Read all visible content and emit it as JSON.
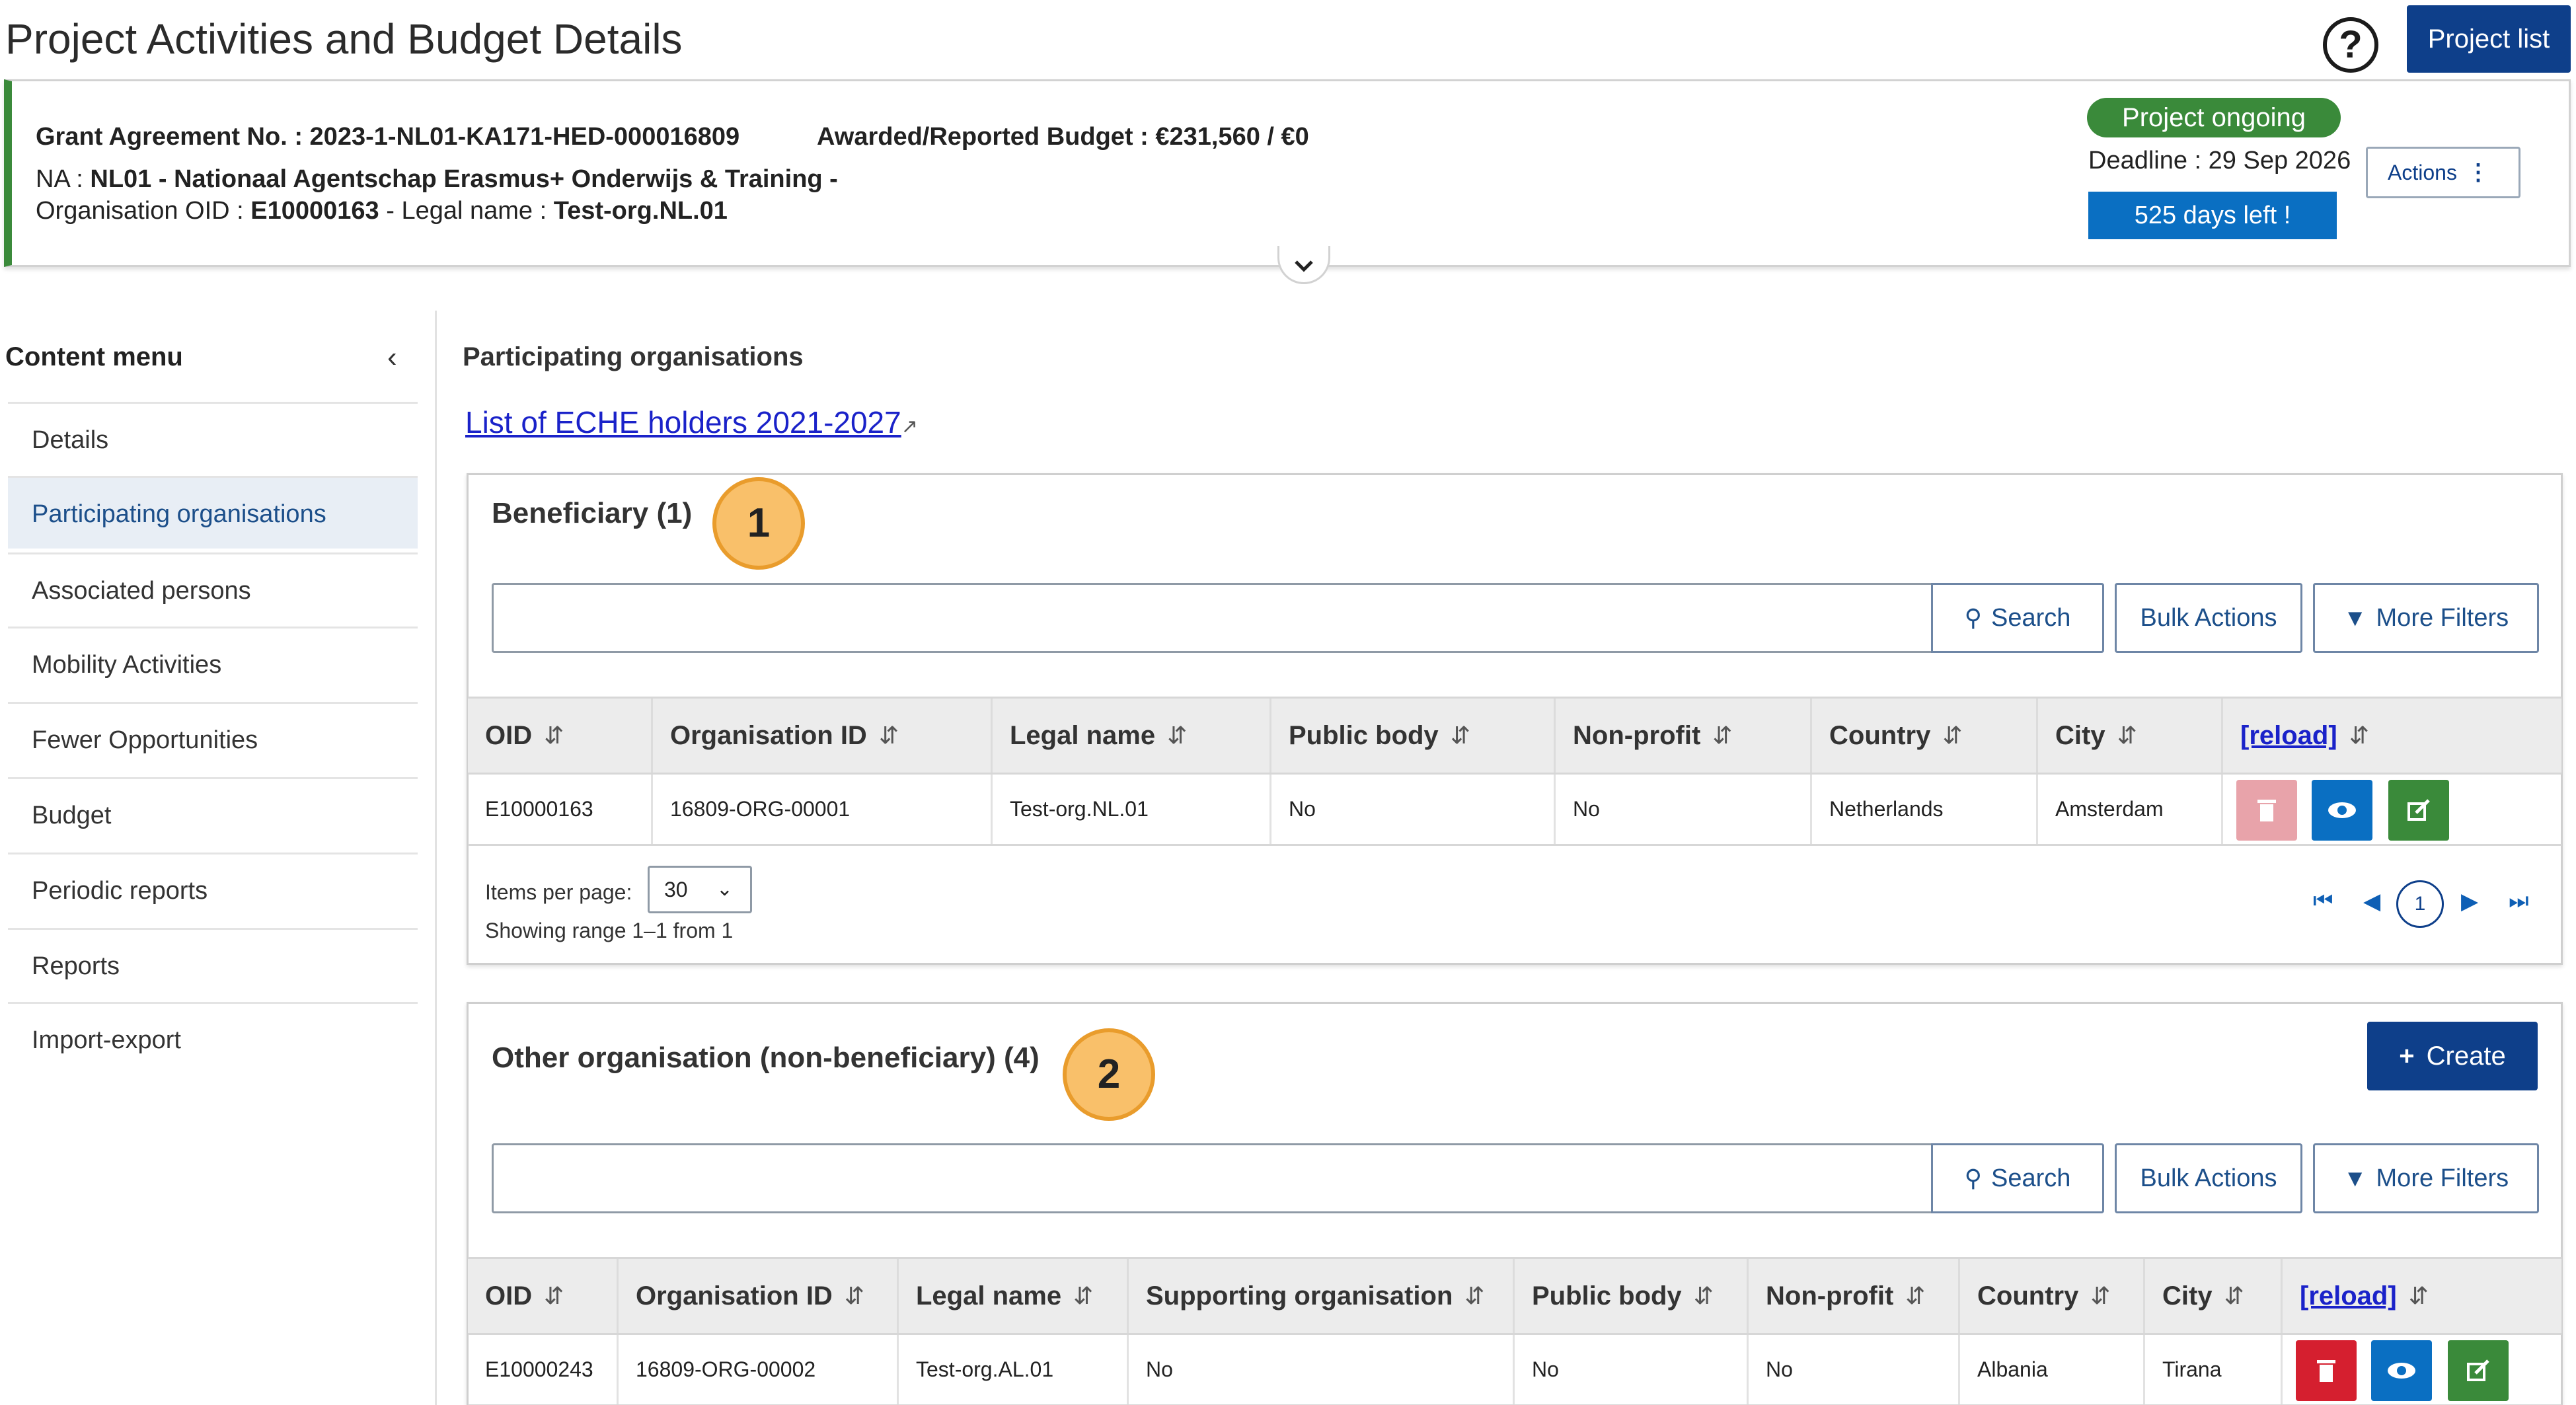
{
  "page": {
    "title": "Project Activities and Budget Details",
    "help_icon": "?",
    "project_list_label": "Project list"
  },
  "header": {
    "grant_label": "Grant Agreement No. :",
    "grant_value": "2023-1-NL01-KA171-HED-000016809",
    "budget_label": "Awarded/Reported Budget :",
    "budget_value": "€231,560 / €0",
    "na_label": "NA :",
    "na_value": "NL01 - Nationaal Agentschap Erasmus+ Onderwijs & Training -",
    "oid_label": "Organisation OID :",
    "oid_value": "E10000163",
    "legal_label": "- Legal name :",
    "legal_value": "Test-org.NL.01",
    "status": "Project ongoing",
    "deadline": "Deadline : 29 Sep 2026",
    "days_left": "525 days left !",
    "actions_label": "Actions",
    "actions_icon": "⋮",
    "colors": {
      "status": "#3a8a3a",
      "days_left": "#0a6fc2",
      "accent_border": "#3b8a3b"
    }
  },
  "sidebar": {
    "title": "Content menu",
    "collapse_icon": "‹",
    "items": [
      {
        "label": "Details"
      },
      {
        "label": "Participating organisations",
        "active": true
      },
      {
        "label": "Associated persons"
      },
      {
        "label": "Mobility Activities"
      },
      {
        "label": "Fewer Opportunities"
      },
      {
        "label": "Budget"
      },
      {
        "label": "Periodic reports"
      },
      {
        "label": "Reports"
      },
      {
        "label": "Import-export"
      }
    ]
  },
  "main": {
    "section_title": "Participating organisations",
    "echel_link": "List of ECHE holders 2021-2027",
    "external_icon": "↗",
    "beneficiary": {
      "title": "Beneficiary (1)",
      "badge": "1",
      "search_label": "Search",
      "bulk_label": "Bulk Actions",
      "filters_label": "More Filters",
      "columns": [
        "OID",
        "Organisation ID",
        "Legal name",
        "Public body",
        "Non-profit",
        "Country",
        "City",
        "[reload]"
      ],
      "sort_icon": "⇵",
      "rows": [
        {
          "oid": "E10000163",
          "org_id": "16809-ORG-00001",
          "legal_name": "Test-org.NL.01",
          "public_body": "No",
          "non_profit": "No",
          "country": "Netherlands",
          "city": "Amsterdam"
        }
      ],
      "items_per_page_label": "Items per page:",
      "items_per_page": "30",
      "range": "Showing range 1–1 from 1",
      "current_page": "1"
    },
    "other": {
      "title": "Other organisation (non-beneficiary) (4)",
      "badge": "2",
      "create_label": "Create",
      "search_label": "Search",
      "bulk_label": "Bulk Actions",
      "filters_label": "More Filters",
      "columns": [
        "OID",
        "Organisation ID",
        "Legal name",
        "Supporting organisation",
        "Public body",
        "Non-profit",
        "Country",
        "City",
        "[reload]"
      ],
      "rows": [
        {
          "oid": "E10000243",
          "org_id": "16809-ORG-00002",
          "legal_name": "Test-org.AL.01",
          "supporting": "No",
          "public_body": "No",
          "non_profit": "No",
          "country": "Albania",
          "city": "Tirana"
        }
      ]
    }
  }
}
